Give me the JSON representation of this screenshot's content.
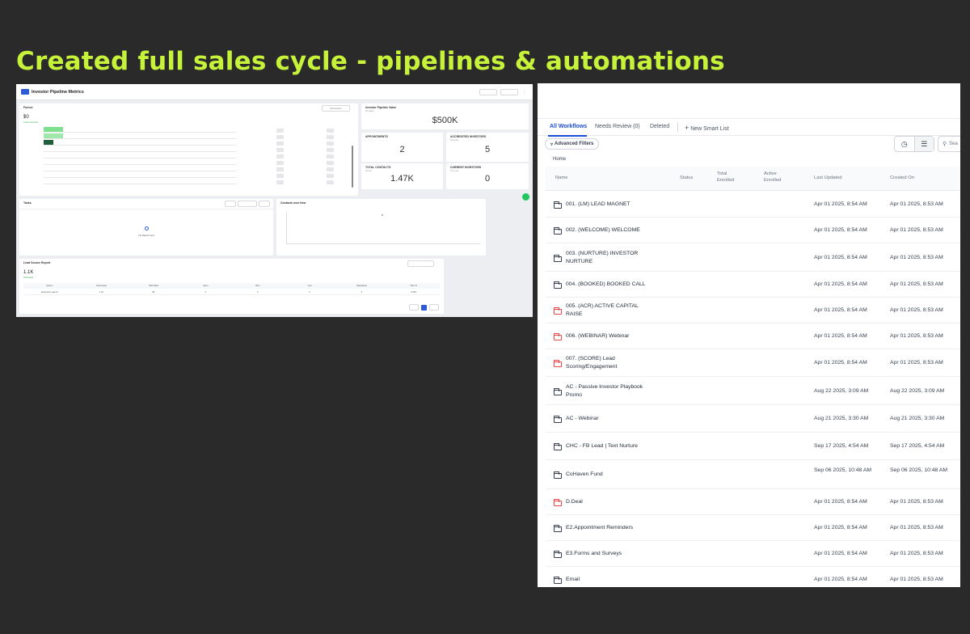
{
  "headline": "Created full sales cycle - pipelines & automations",
  "dashboard": {
    "title": "Investor Pipeline Metrics",
    "funnel": {
      "title": "Funnel",
      "value": "$0",
      "sub": "Lead conversion",
      "filter": "All Investors"
    },
    "investor_pipeline_value": {
      "title": "Investor Pipeline Value",
      "sub": "All stages",
      "value": "$500K"
    },
    "appointments": {
      "title": "APPOINTMENTS",
      "value": "2"
    },
    "accredited_investors": {
      "title": "ACCREDITED INVESTORS",
      "sub": "This year",
      "value": "5"
    },
    "total_contacts": {
      "title": "TOTAL CONTACTS",
      "sub": "All time",
      "value": "1.47K"
    },
    "current_investors": {
      "title": "CURRENT INVESTORS",
      "sub": "This year",
      "value": "0"
    },
    "tasks": {
      "title": "Tasks",
      "no_data": "No Data Found"
    },
    "contacts_chart": {
      "title": "Contacts over time"
    },
    "lead_source": {
      "title": "Lead Source Report",
      "value": "1.1K",
      "sub": "Total leads",
      "columns": [
        "Source",
        "Total Leads",
        "Total Value",
        "Open",
        "Won",
        "Lost",
        "Abandoned",
        "Won %"
      ],
      "rows": [
        [
          "Facebook Lead Ad",
          "1.1K",
          "$0",
          "0",
          "0",
          "0",
          "0",
          "0.00%"
        ]
      ]
    }
  },
  "workflows": {
    "tabs": [
      "All Workflows",
      "Needs Review (0)",
      "Deleted"
    ],
    "new_smart_list": "New Smart List",
    "advanced_filters": "Advanced Filters",
    "search_placeholder": "Sea",
    "breadcrumb": "Home",
    "columns": {
      "name": "Name",
      "status": "Status",
      "total_enrolled": "Total Enrolled",
      "active_enrolled": "Active Enrolled",
      "last_updated": "Last Updated",
      "created_on": "Created On"
    },
    "rows": [
      {
        "name": "001. (LM) LEAD MAGNET",
        "icon": "folder-icon",
        "updated": "Apr 01 2025, 8:54 AM",
        "created": "Apr 01 2025, 8:53 AM"
      },
      {
        "name": "002. (WELCOME) WELCOME",
        "icon": "folder-icon",
        "updated": "Apr 01 2025, 8:54 AM",
        "created": "Apr 01 2025, 8:53 AM"
      },
      {
        "name": "003. (NURTURE) INVESTOR NURTURE",
        "icon": "folder-icon",
        "updated": "Apr 01 2025, 8:54 AM",
        "created": "Apr 01 2025, 8:53 AM"
      },
      {
        "name": "004. (BOOKED) BOOKED CALL",
        "icon": "folder-icon",
        "updated": "Apr 01 2025, 8:54 AM",
        "created": "Apr 01 2025, 8:53 AM"
      },
      {
        "name": "005. (ACR) ACTIVE CAPITAL RAISE",
        "icon": "folder-red-icon",
        "updated": "Apr 01 2025, 8:54 AM",
        "created": "Apr 01 2025, 8:53 AM"
      },
      {
        "name": "006. (WEBINAR) Webinar",
        "icon": "folder-red-icon",
        "updated": "Apr 01 2025, 8:54 AM",
        "created": "Apr 01 2025, 8:53 AM"
      },
      {
        "name": "007. (SCORE) Lead Scoring/Engagement",
        "icon": "folder-red-icon",
        "updated": "Apr 01 2025, 8:54 AM",
        "created": "Apr 01 2025, 8:53 AM"
      },
      {
        "name": "AC - Passive Investor Playbook Promo",
        "icon": "folder-icon",
        "updated": "Aug 22 2025, 3:09 AM",
        "created": "Aug 22 2025, 3:09 AM"
      },
      {
        "name": "AC - Webinar",
        "icon": "folder-icon",
        "updated": "Aug 21 2025, 3:30 AM",
        "created": "Aug 21 2025, 3:30 AM"
      },
      {
        "name": "CHC - FB Lead | Text Nurture",
        "icon": "folder-icon",
        "updated": "Sep 17 2025, 4:54 AM",
        "created": "Sep 17 2025, 4:54 AM"
      },
      {
        "name": "CoHaven Fund",
        "icon": "folder-icon",
        "updated": "Sep 06 2025, 10:48 AM",
        "created": "Sep 06 2025, 10:48 AM"
      },
      {
        "name": "D.Deal",
        "icon": "folder-red-icon",
        "updated": "Apr 01 2025, 8:54 AM",
        "created": "Apr 01 2025, 8:53 AM"
      },
      {
        "name": "E2.Appointment Reminders",
        "icon": "folder-icon",
        "updated": "Apr 01 2025, 8:54 AM",
        "created": "Apr 01 2025, 8:53 AM"
      },
      {
        "name": "E3.Forms and Surveys",
        "icon": "folder-icon",
        "updated": "Apr 01 2025, 8:54 AM",
        "created": "Apr 01 2025, 8:53 AM"
      },
      {
        "name": "Email",
        "icon": "folder-icon",
        "updated": "Apr 01 2025, 8:54 AM",
        "created": "Apr 01 2025, 8:53 AM"
      }
    ]
  },
  "colors": {
    "headline": "#c6f23a",
    "accent": "#1d4ed8",
    "folder_red": "#ef4444",
    "background": "#2a2a2a"
  }
}
